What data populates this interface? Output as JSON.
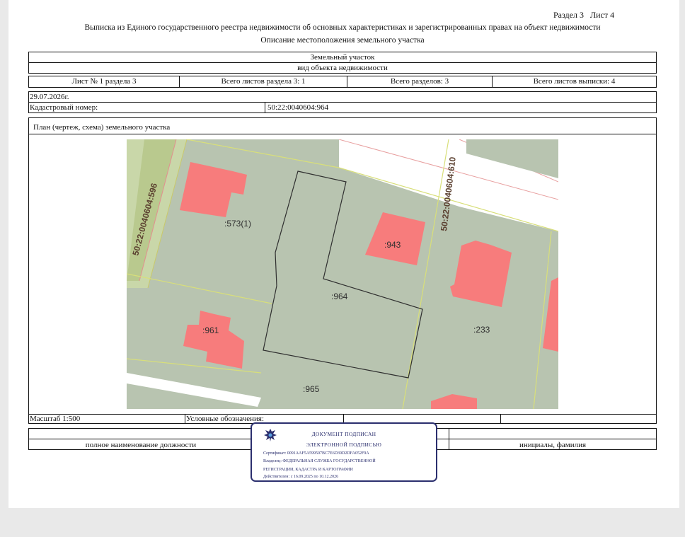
{
  "header": {
    "section_sheet": "Раздел 3   Лист 4",
    "title": "Выписка из Единого государственного реестра недвижимости об основных характеристиках и зарегистрированных правах на объект недвижимости",
    "subtitle": "Описание местоположения земельного участка"
  },
  "object": {
    "type": "Земельный участок",
    "type_caption": "вид объекта недвижимости"
  },
  "sheet_info": {
    "sheet_of_section": "Лист № 1 раздела 3",
    "total_sheets_section": "Всего листов раздела 3: 1",
    "total_sections": "Всего разделов: 3",
    "total_sheets_extract": "Всего листов выписки: 4"
  },
  "date": "29.07.2026г.",
  "cadastral": {
    "label": "Кадастровый номер:",
    "value": "50:22:0040604:964"
  },
  "plan": {
    "title": "План (чертеж, схема) земельного участка",
    "labels": {
      "p573": ":573(1)",
      "p943": ":943",
      "p964": ":964",
      "p961": ":961",
      "p233": ":233",
      "p965": ":965",
      "block596": "50:22:0040604:596",
      "block610": "50:22:0040604:610"
    }
  },
  "footer": {
    "scale": "Масштаб 1:500",
    "legend": "Условные обозначения:",
    "position_caption": "полное наименование должности",
    "name_caption": "инициалы, фамилия"
  },
  "stamp": {
    "line1": "ДОКУМЕНТ ПОДПИСАН",
    "line2": "ЭЛЕКТРОННОЙ ПОДПИСЬЮ",
    "certificate": "Сертификат: 0091AAF5A599507BC7E6D39D2DFA052F9A",
    "owner1": "Владелец: ФЕДЕРАЛЬНАЯ СЛУЖБА ГОСУДАРСТВЕННОЙ",
    "owner2": "РЕГИСТРАЦИИ, КАДАСТРА И КАРТОГРАФИИ",
    "valid": "Действителен: с 16.09.2025 по 10.12.2026"
  },
  "colors": {
    "parcel": "#b8c4b0",
    "building": "#f77c7c",
    "stamp": "#2b2f6e"
  }
}
